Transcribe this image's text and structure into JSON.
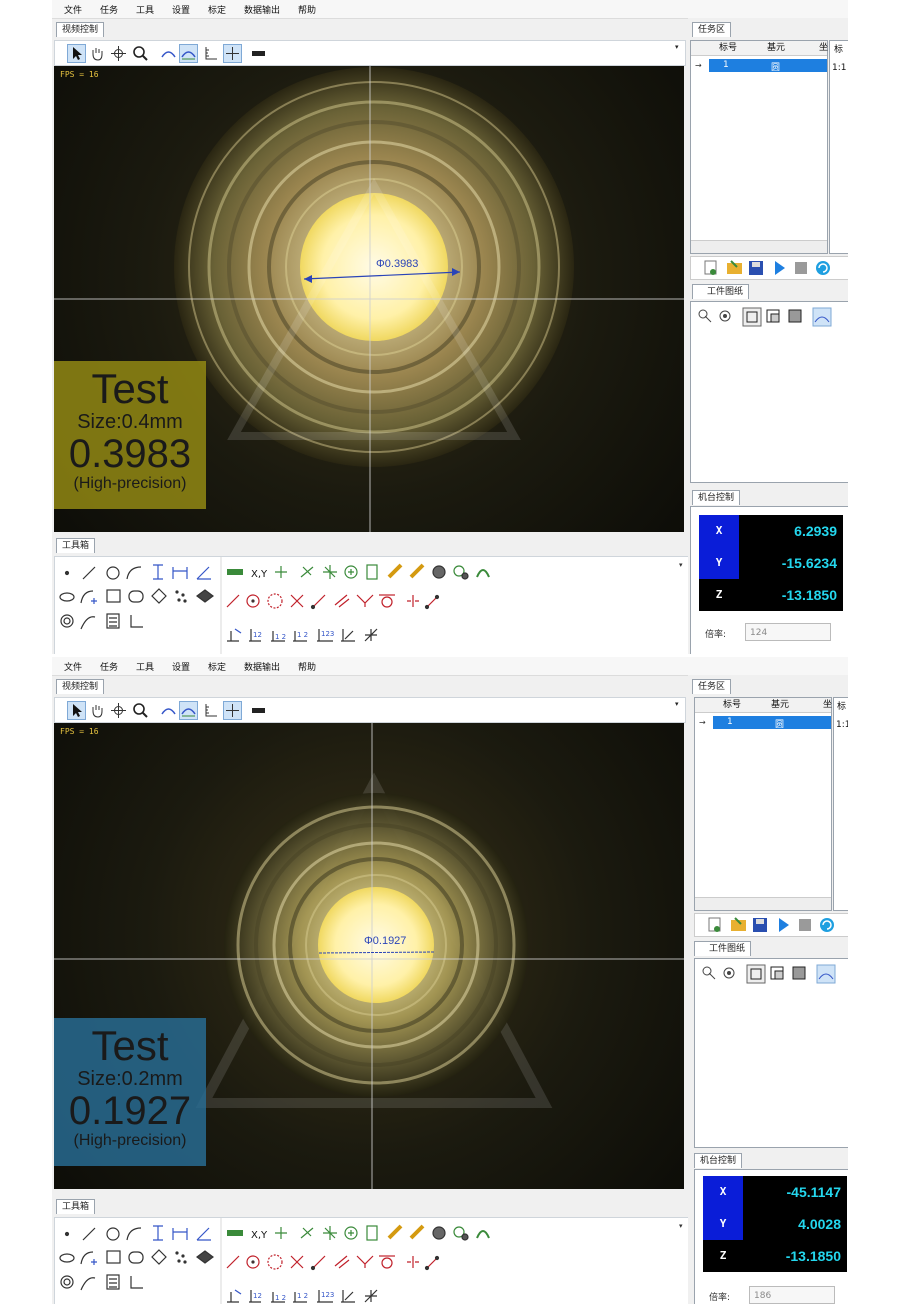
{
  "menu": [
    "文件",
    "任务",
    "工具",
    "设置",
    "标定",
    "数据输出",
    "帮助"
  ],
  "tabs": {
    "video_control": "视频控制",
    "task_area": "任务区",
    "workpiece_drawing": "工件图纸",
    "toolbox": "工具箱",
    "stage_control": "机台控制"
  },
  "task_table": {
    "headers": [
      "标号",
      "基元",
      "坐"
    ],
    "row": {
      "id": "1",
      "element": "圆"
    },
    "side_header": "标",
    "side_value": "1:1"
  },
  "zoom_label": "倍率:",
  "colors": {
    "selection": "#1e7fe0",
    "coord_cyan": "#24d7ee",
    "coord_blue": "#0a1dd8",
    "overlay_top": "#968c14",
    "overlay_bottom": "#286e96"
  },
  "panels": [
    {
      "fps": "FPS = 16",
      "measurement": "Φ0.3983",
      "overlay": {
        "title": "Test",
        "size": "Size:0.4mm",
        "value": "0.3983",
        "note": "(High-precision)"
      },
      "coords": {
        "x_label": "X",
        "x": "6.2939",
        "y_label": "Y",
        "y": "-15.6234",
        "z_label": "Z",
        "z": "-13.1850"
      },
      "zoom": "124"
    },
    {
      "fps": "FPS = 16",
      "measurement": "Φ0.1927",
      "overlay": {
        "title": "Test",
        "size": "Size:0.2mm",
        "value": "0.1927",
        "note": "(High-precision)"
      },
      "coords": {
        "x_label": "X",
        "x": "-45.1147",
        "y_label": "Y",
        "y": "4.0028",
        "z_label": "Z",
        "z": "-13.1850"
      },
      "zoom": "186"
    }
  ]
}
